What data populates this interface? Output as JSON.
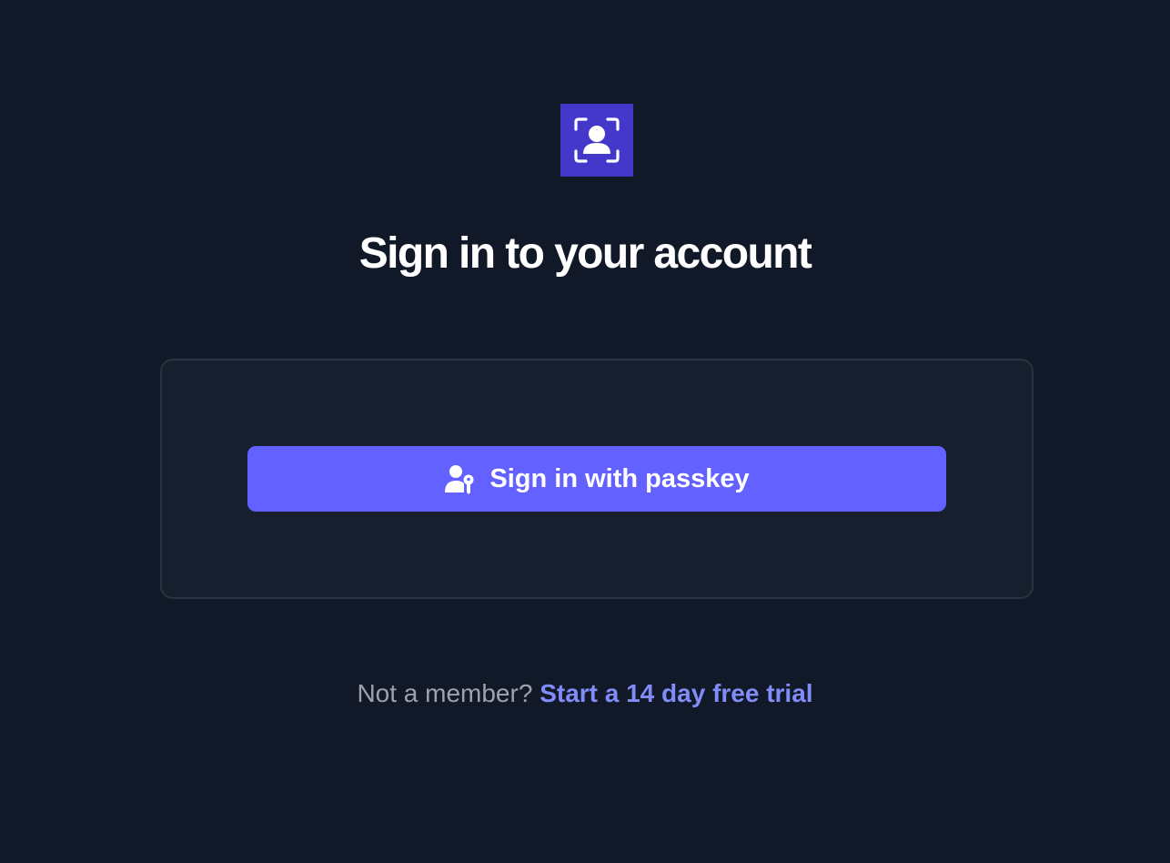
{
  "app": {
    "logo_icon": "user-scan-icon",
    "brand_color": "#4338ca"
  },
  "heading": {
    "title": "Sign in to your account"
  },
  "card": {
    "passkey_button": {
      "label": "Sign in with passkey",
      "icon": "user-key-icon",
      "color": "#6361ff"
    }
  },
  "footer": {
    "prompt": "Not a member?",
    "link_label": "Start a 14 day free trial",
    "link_color": "#818cf8"
  }
}
